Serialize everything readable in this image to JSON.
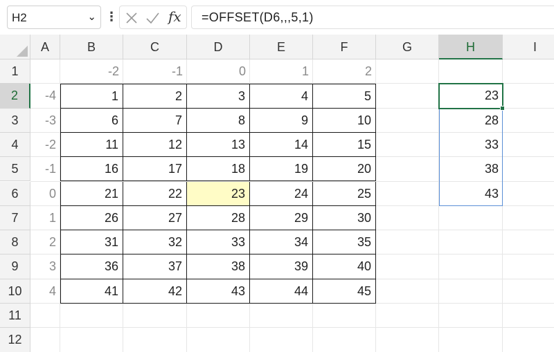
{
  "formula_bar": {
    "name_box": "H2",
    "name_box_arrow": "⌄",
    "more_icon": "⋮",
    "fx_label": "fx",
    "formula": "=OFFSET(D6,,,5,1)"
  },
  "columns": [
    "A",
    "B",
    "C",
    "D",
    "E",
    "F",
    "G",
    "H",
    "I"
  ],
  "rows": [
    "1",
    "2",
    "3",
    "4",
    "5",
    "6",
    "7",
    "8",
    "9",
    "10",
    "11",
    "12"
  ],
  "selected_column": "H",
  "selected_row": "2",
  "col_offsets": [
    "-2",
    "-1",
    "0",
    "1",
    "2"
  ],
  "row_offsets": [
    "-4",
    "-3",
    "-2",
    "-1",
    "0",
    "1",
    "2",
    "3",
    "4"
  ],
  "table": [
    [
      "1",
      "2",
      "3",
      "4",
      "5"
    ],
    [
      "6",
      "7",
      "8",
      "9",
      "10"
    ],
    [
      "11",
      "12",
      "13",
      "14",
      "15"
    ],
    [
      "16",
      "17",
      "18",
      "19",
      "20"
    ],
    [
      "21",
      "22",
      "23",
      "24",
      "25"
    ],
    [
      "26",
      "27",
      "28",
      "29",
      "30"
    ],
    [
      "31",
      "32",
      "33",
      "34",
      "35"
    ],
    [
      "36",
      "37",
      "38",
      "39",
      "40"
    ],
    [
      "41",
      "42",
      "43",
      "44",
      "45"
    ]
  ],
  "highlighted_cell": "D6",
  "spill_results": [
    "23",
    "28",
    "33",
    "38",
    "43"
  ],
  "colors": {
    "accent": "#217346",
    "highlight": "#fffcc6",
    "spill_border": "#5a8ed6",
    "offset_text": "#8a8a8a"
  }
}
